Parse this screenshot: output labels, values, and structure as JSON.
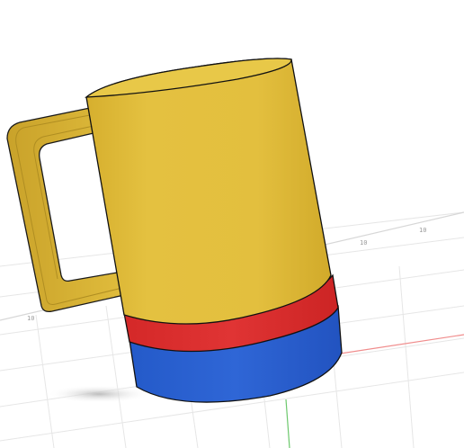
{
  "viewport": {
    "grid_labels": [
      "10",
      "10",
      "10"
    ]
  },
  "model": {
    "name": "mug",
    "parts": [
      {
        "name": "mug-body",
        "color": "#E2BE3C"
      },
      {
        "name": "mug-handle",
        "color": "#DDB83A"
      },
      {
        "name": "red-band",
        "color": "#DD2E2E"
      },
      {
        "name": "blue-base",
        "color": "#2D62D3"
      }
    ]
  },
  "colors": {
    "background": "#FFFFFF",
    "grid": "#E4E4E4",
    "x_axis": "#F08C8C",
    "y_axis": "#6CC86C",
    "outline": "#1A1A1A"
  }
}
